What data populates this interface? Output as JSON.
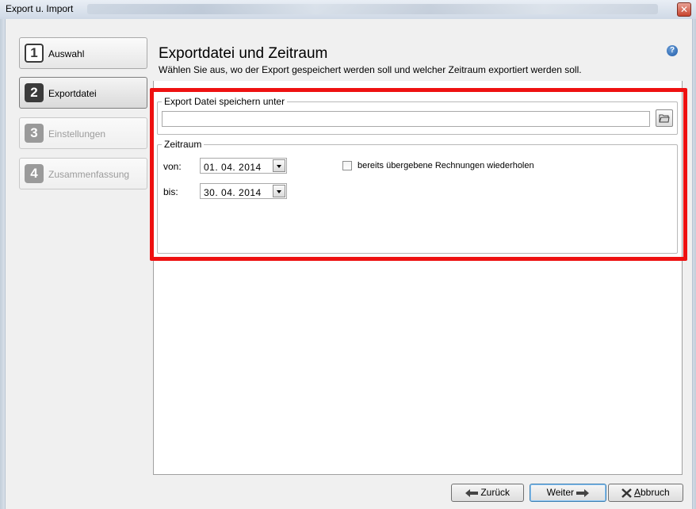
{
  "window": {
    "title": "Export u. Import"
  },
  "steps": [
    {
      "num": "1",
      "label": "Auswahl"
    },
    {
      "num": "2",
      "label": "Exportdatei"
    },
    {
      "num": "3",
      "label": "Einstellungen"
    },
    {
      "num": "4",
      "label": "Zusammenfassung"
    }
  ],
  "header": {
    "title": "Exportdatei und Zeitraum",
    "description": "Wählen Sie aus, wo der Export gespeichert werden soll und welcher Zeitraum exportiert werden soll."
  },
  "export_group": {
    "legend": "Export Datei speichern unter",
    "path_value": ""
  },
  "zeitraum": {
    "legend": "Zeitraum",
    "von_label": "von:",
    "von_value": "01. 04. 2014",
    "bis_label": "bis:",
    "bis_value": "30. 04. 2014",
    "repeat_label": "bereits übergebene Rechnungen wiederholen"
  },
  "buttons": {
    "back": "Zurück",
    "next": "Weiter",
    "cancel_prefix": "A",
    "cancel_rest": "bbruch"
  },
  "colors": {
    "highlight": "#ee1111",
    "accent": "#1f5aa8"
  }
}
